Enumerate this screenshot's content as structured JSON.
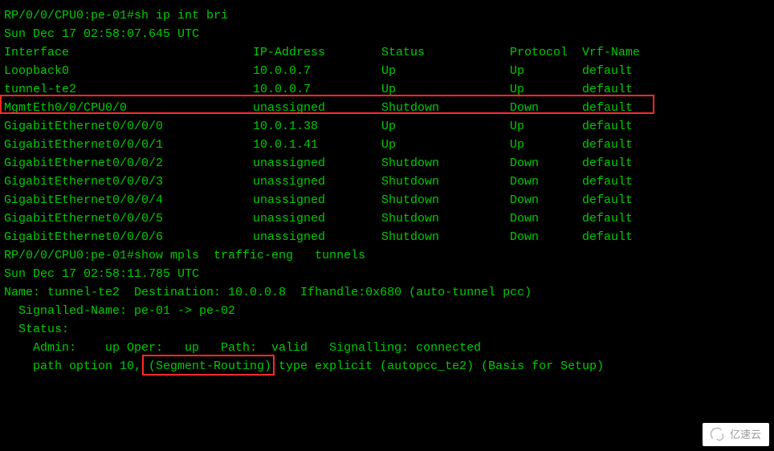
{
  "lines": {
    "cmd1": "RP/0/0/CPU0:pe-01#sh ip int bri",
    "time1": "Sun Dec 17 02:58:07.645 UTC",
    "blank": "",
    "cmd2": "RP/0/0/CPU0:pe-01#show mpls  traffic-eng   tunnels",
    "time2": "Sun Dec 17 02:58:11.785 UTC",
    "tun_name": "Name: tunnel-te2  Destination: 10.0.0.8  Ifhandle:0x680 (auto-tunnel pcc)",
    "sig_name": "  Signalled-Name: pe-01 -> pe-02",
    "status_hdr": "  Status:",
    "status_line": "    Admin:    up Oper:   up   Path:  valid   Signalling: connected",
    "path_option": "    path option 10, (Segment-Routing) type explicit (autopcc_te2) (Basis for Setup)"
  },
  "table": {
    "headers": {
      "interface": "Interface",
      "ip": "IP-Address",
      "status": "Status",
      "protocol": "Protocol",
      "vrf": "Vrf-Name"
    },
    "rows": [
      {
        "interface": "Loopback0",
        "ip": "10.0.0.7",
        "status": "Up",
        "protocol": "Up",
        "vrf": "default"
      },
      {
        "interface": "tunnel-te2",
        "ip": "10.0.0.7",
        "status": "Up",
        "protocol": "Up",
        "vrf": "default"
      },
      {
        "interface": "MgmtEth0/0/CPU0/0",
        "ip": "unassigned",
        "status": "Shutdown",
        "protocol": "Down",
        "vrf": "default"
      },
      {
        "interface": "GigabitEthernet0/0/0/0",
        "ip": "10.0.1.38",
        "status": "Up",
        "protocol": "Up",
        "vrf": "default"
      },
      {
        "interface": "GigabitEthernet0/0/0/1",
        "ip": "10.0.1.41",
        "status": "Up",
        "protocol": "Up",
        "vrf": "default"
      },
      {
        "interface": "GigabitEthernet0/0/0/2",
        "ip": "unassigned",
        "status": "Shutdown",
        "protocol": "Down",
        "vrf": "default"
      },
      {
        "interface": "GigabitEthernet0/0/0/3",
        "ip": "unassigned",
        "status": "Shutdown",
        "protocol": "Down",
        "vrf": "default"
      },
      {
        "interface": "GigabitEthernet0/0/0/4",
        "ip": "unassigned",
        "status": "Shutdown",
        "protocol": "Down",
        "vrf": "default"
      },
      {
        "interface": "GigabitEthernet0/0/0/5",
        "ip": "unassigned",
        "status": "Shutdown",
        "protocol": "Down",
        "vrf": "default"
      },
      {
        "interface": "GigabitEthernet0/0/0/6",
        "ip": "unassigned",
        "status": "Shutdown",
        "protocol": "Down",
        "vrf": "default"
      }
    ]
  },
  "watermark": "亿速云"
}
